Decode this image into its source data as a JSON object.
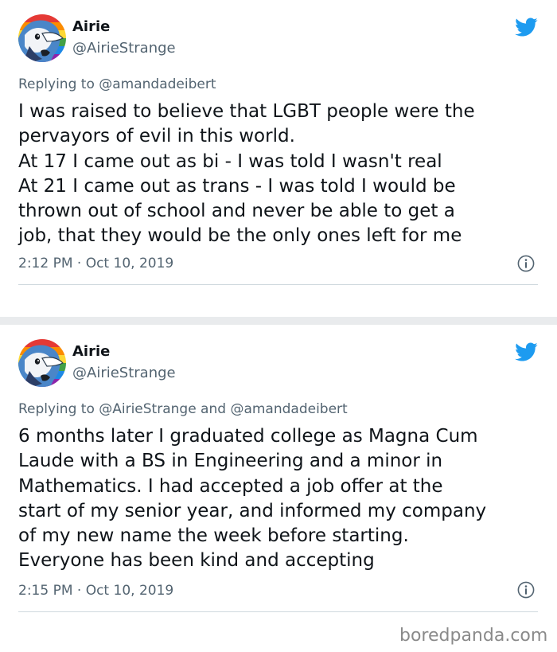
{
  "tweets": [
    {
      "author_name": "Airie",
      "author_handle": "@AirieStrange",
      "reply_to": "Replying to @amandadeibert",
      "body_lines": [
        "I was raised to believe that LGBT people were the",
        "pervayors of evil in this world.",
        "At 17 I came out as bi - I was told I wasn't real",
        "At 21 I came out as trans - I was told I would be",
        "thrown out of school and never be able to get a",
        "job, that they would be the only ones left for me"
      ],
      "timestamp": "2:12 PM · Oct 10, 2019",
      "icons": {
        "avatar": "avatar-image",
        "brand": "twitter-bird-icon",
        "info": "info-icon"
      }
    },
    {
      "author_name": "Airie",
      "author_handle": "@AirieStrange",
      "reply_to": "Replying to @AirieStrange and @amandadeibert",
      "body_lines": [
        "6 months later I graduated college as Magna Cum",
        "Laude with a BS in Engineering and a minor in",
        "Mathematics. I had accepted a job offer at the",
        "start of my senior year, and informed my company",
        "of my new name the week before starting.",
        "Everyone has been kind and accepting"
      ],
      "timestamp": "2:15 PM · Oct 10, 2019",
      "icons": {
        "avatar": "avatar-image",
        "brand": "twitter-bird-icon",
        "info": "info-icon"
      }
    }
  ],
  "watermark": "boredpanda.com",
  "colors": {
    "twitter_blue": "#1d9bf0",
    "text_primary": "#0f1419",
    "text_secondary": "#536471",
    "divider": "#cfd9de",
    "separator_background": "#e9ebed"
  }
}
